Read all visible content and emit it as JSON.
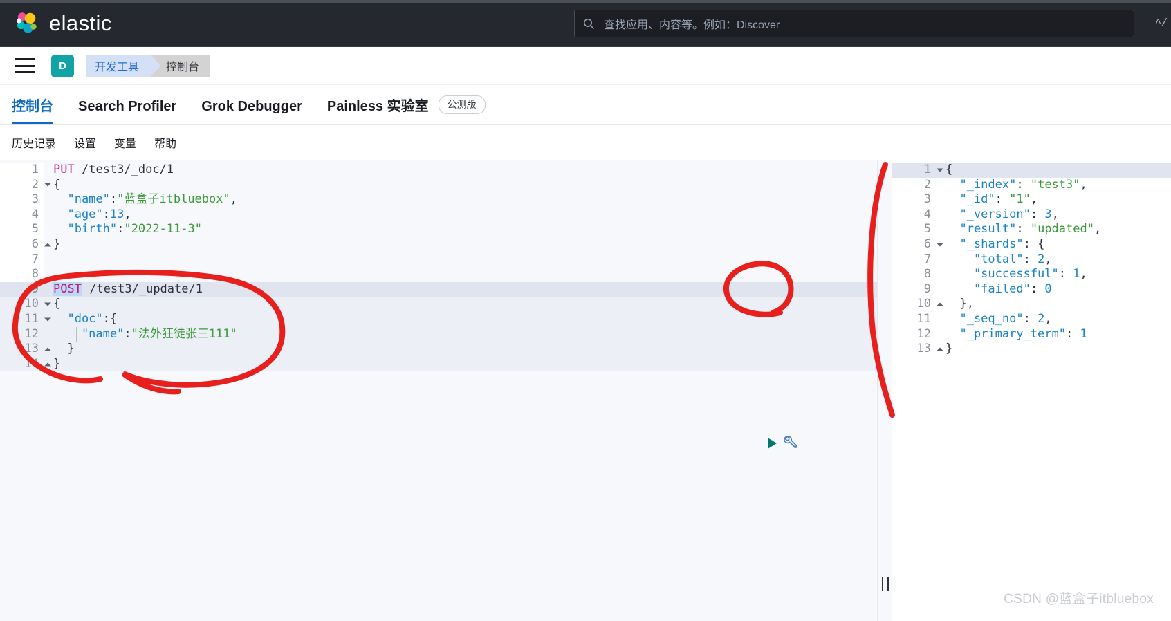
{
  "topbar": {
    "brand": "elastic",
    "logo_icon": "elastic-logo-icon",
    "search": {
      "icon": "search-icon",
      "placeholder": "查找应用、内容等。例如：Discover",
      "value": "",
      "shortcut_hint": "^/"
    }
  },
  "breadcrumb_bar": {
    "menu_icon": "hamburger-menu-icon",
    "space_avatar": "D",
    "items": [
      {
        "label": "开发工具"
      },
      {
        "label": "控制台"
      }
    ]
  },
  "app_tabs": [
    {
      "label": "控制台",
      "active": true,
      "badge": ""
    },
    {
      "label": "Search Profiler",
      "active": false,
      "badge": ""
    },
    {
      "label": "Grok Debugger",
      "active": false,
      "badge": ""
    },
    {
      "label": "Painless 实验室",
      "active": false,
      "badge": "公测版"
    }
  ],
  "submenu": [
    {
      "label": "历史记录"
    },
    {
      "label": "设置"
    },
    {
      "label": "变量"
    },
    {
      "label": "帮助"
    }
  ],
  "editor": {
    "actions": {
      "play_icon": "play-triangle-icon",
      "wrench_icon": "wrench-icon"
    },
    "lines": [
      {
        "n": "1",
        "fold": "",
        "highlight": "",
        "indent_guide": false,
        "tokens": [
          {
            "t": "method",
            "v": "PUT"
          },
          {
            "t": "plain",
            "v": " "
          },
          {
            "t": "url",
            "v": "/test3/_doc/1"
          }
        ]
      },
      {
        "n": "2",
        "fold": "down",
        "highlight": "",
        "indent_guide": false,
        "tokens": [
          {
            "t": "punct",
            "v": "{"
          }
        ]
      },
      {
        "n": "3",
        "fold": "",
        "highlight": "",
        "indent_guide": false,
        "tokens": [
          {
            "t": "key",
            "v": "  \"name\""
          },
          {
            "t": "punct",
            "v": ":"
          },
          {
            "t": "str",
            "v": "\"蓝盒子itbluebox\""
          },
          {
            "t": "punct",
            "v": ","
          }
        ]
      },
      {
        "n": "4",
        "fold": "",
        "highlight": "",
        "indent_guide": false,
        "tokens": [
          {
            "t": "key",
            "v": "  \"age\""
          },
          {
            "t": "punct",
            "v": ":"
          },
          {
            "t": "num",
            "v": "13"
          },
          {
            "t": "punct",
            "v": ","
          }
        ]
      },
      {
        "n": "5",
        "fold": "",
        "highlight": "",
        "indent_guide": false,
        "tokens": [
          {
            "t": "key",
            "v": "  \"birth\""
          },
          {
            "t": "punct",
            "v": ":"
          },
          {
            "t": "str",
            "v": "\"2022-11-3\""
          }
        ]
      },
      {
        "n": "6",
        "fold": "up",
        "highlight": "",
        "indent_guide": false,
        "tokens": [
          {
            "t": "punct",
            "v": "}"
          }
        ]
      },
      {
        "n": "7",
        "fold": "",
        "highlight": "",
        "indent_guide": false,
        "tokens": []
      },
      {
        "n": "8",
        "fold": "",
        "highlight": "",
        "indent_guide": false,
        "tokens": []
      },
      {
        "n": "9",
        "fold": "",
        "highlight": "hl",
        "indent_guide": false,
        "tokens": [
          {
            "t": "sel-method",
            "v": "POST"
          },
          {
            "t": "caret",
            "v": ""
          },
          {
            "t": "plain",
            "v": " "
          },
          {
            "t": "url",
            "v": "/test3/_update/1"
          }
        ]
      },
      {
        "n": "10",
        "fold": "down",
        "highlight": "hl-soft",
        "indent_guide": false,
        "tokens": [
          {
            "t": "punct",
            "v": "{"
          }
        ]
      },
      {
        "n": "11",
        "fold": "down",
        "highlight": "hl-soft",
        "indent_guide": false,
        "tokens": [
          {
            "t": "key",
            "v": "  \"doc\""
          },
          {
            "t": "punct",
            "v": ":{"
          }
        ]
      },
      {
        "n": "12",
        "fold": "",
        "highlight": "hl-soft",
        "indent_guide": true,
        "tokens": [
          {
            "t": "key",
            "v": "    \"name\""
          },
          {
            "t": "punct",
            "v": ":"
          },
          {
            "t": "str",
            "v": "\"法外狂徒张三111\""
          }
        ]
      },
      {
        "n": "13",
        "fold": "up",
        "highlight": "hl-soft",
        "indent_guide": false,
        "tokens": [
          {
            "t": "punct",
            "v": "  }"
          }
        ]
      },
      {
        "n": "14",
        "fold": "up",
        "highlight": "hl-soft",
        "indent_guide": false,
        "tokens": [
          {
            "t": "punct",
            "v": "}"
          }
        ]
      }
    ]
  },
  "response": {
    "lines": [
      {
        "n": "1",
        "fold": "down",
        "highlight": "hl",
        "indent_guide": false,
        "tokens": [
          {
            "t": "punct",
            "v": "{"
          }
        ]
      },
      {
        "n": "2",
        "fold": "",
        "highlight": "",
        "indent_guide": false,
        "tokens": [
          {
            "t": "key",
            "v": "  \"_index\""
          },
          {
            "t": "punct",
            "v": ": "
          },
          {
            "t": "str",
            "v": "\"test3\""
          },
          {
            "t": "punct",
            "v": ","
          }
        ]
      },
      {
        "n": "3",
        "fold": "",
        "highlight": "",
        "indent_guide": false,
        "tokens": [
          {
            "t": "key",
            "v": "  \"_id\""
          },
          {
            "t": "punct",
            "v": ": "
          },
          {
            "t": "str",
            "v": "\"1\""
          },
          {
            "t": "punct",
            "v": ","
          }
        ]
      },
      {
        "n": "4",
        "fold": "",
        "highlight": "",
        "indent_guide": false,
        "tokens": [
          {
            "t": "key",
            "v": "  \"_version\""
          },
          {
            "t": "punct",
            "v": ": "
          },
          {
            "t": "num",
            "v": "3"
          },
          {
            "t": "punct",
            "v": ","
          }
        ]
      },
      {
        "n": "5",
        "fold": "",
        "highlight": "",
        "indent_guide": false,
        "tokens": [
          {
            "t": "key",
            "v": "  \"result\""
          },
          {
            "t": "punct",
            "v": ": "
          },
          {
            "t": "str",
            "v": "\"updated\""
          },
          {
            "t": "punct",
            "v": ","
          }
        ]
      },
      {
        "n": "6",
        "fold": "down",
        "highlight": "",
        "indent_guide": false,
        "tokens": [
          {
            "t": "key",
            "v": "  \"_shards\""
          },
          {
            "t": "punct",
            "v": ": {"
          }
        ]
      },
      {
        "n": "7",
        "fold": "",
        "highlight": "",
        "indent_guide": true,
        "tokens": [
          {
            "t": "key",
            "v": "    \"total\""
          },
          {
            "t": "punct",
            "v": ": "
          },
          {
            "t": "num",
            "v": "2"
          },
          {
            "t": "punct",
            "v": ","
          }
        ]
      },
      {
        "n": "8",
        "fold": "",
        "highlight": "",
        "indent_guide": true,
        "tokens": [
          {
            "t": "key",
            "v": "    \"successful\""
          },
          {
            "t": "punct",
            "v": ": "
          },
          {
            "t": "num",
            "v": "1"
          },
          {
            "t": "punct",
            "v": ","
          }
        ]
      },
      {
        "n": "9",
        "fold": "",
        "highlight": "",
        "indent_guide": true,
        "tokens": [
          {
            "t": "key",
            "v": "    \"failed\""
          },
          {
            "t": "punct",
            "v": ": "
          },
          {
            "t": "num",
            "v": "0"
          }
        ]
      },
      {
        "n": "10",
        "fold": "up",
        "highlight": "",
        "indent_guide": false,
        "tokens": [
          {
            "t": "punct",
            "v": "  },"
          }
        ]
      },
      {
        "n": "11",
        "fold": "",
        "highlight": "",
        "indent_guide": false,
        "tokens": [
          {
            "t": "key",
            "v": "  \"_seq_no\""
          },
          {
            "t": "punct",
            "v": ": "
          },
          {
            "t": "num",
            "v": "2"
          },
          {
            "t": "punct",
            "v": ","
          }
        ]
      },
      {
        "n": "12",
        "fold": "",
        "highlight": "",
        "indent_guide": false,
        "tokens": [
          {
            "t": "key",
            "v": "  \"_primary_term\""
          },
          {
            "t": "punct",
            "v": ": "
          },
          {
            "t": "num",
            "v": "1"
          }
        ]
      },
      {
        "n": "13",
        "fold": "up",
        "highlight": "",
        "indent_guide": false,
        "tokens": [
          {
            "t": "punct",
            "v": "}"
          }
        ]
      }
    ]
  },
  "splitter": {
    "grip_icon": "resize-grip-icon"
  },
  "annotations": {
    "color": "#e8201d",
    "shapes": [
      "circle-around-update-request",
      "circle-around-play-button",
      "vertical-stroke-beside-response"
    ]
  },
  "watermark": "CSDN @蓝盒子itbluebox",
  "colors": {
    "topbar_bg": "#25282f",
    "accent_blue": "#0d6ac4",
    "space_teal": "#12a4a4",
    "annotation_red": "#e8201d",
    "play_green": "#00786b"
  }
}
